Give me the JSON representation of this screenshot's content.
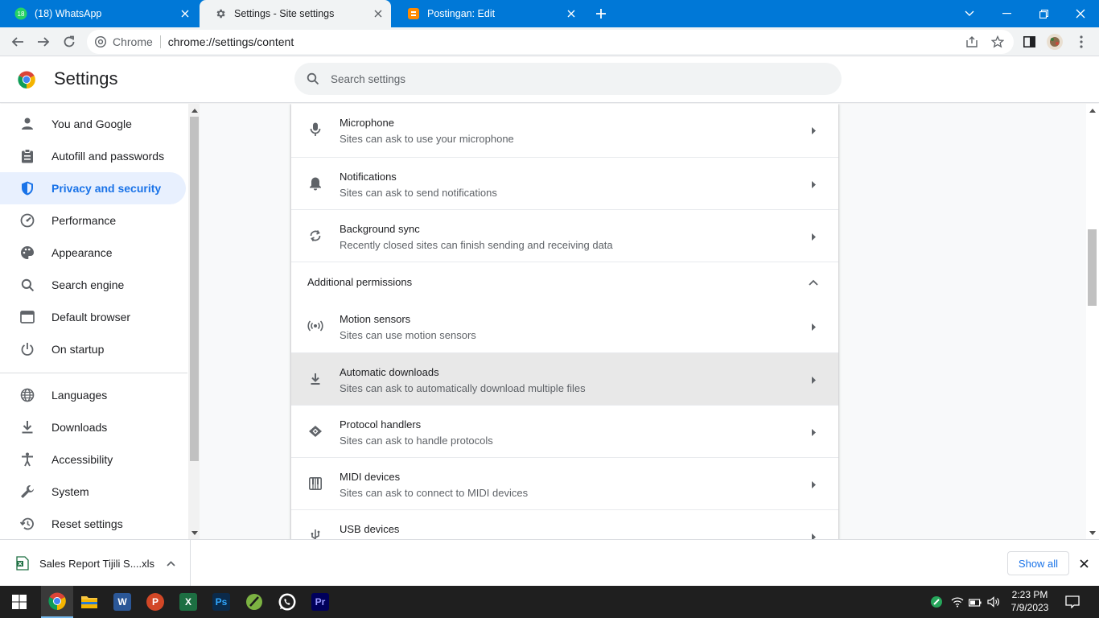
{
  "tabs": [
    {
      "title": "(18) WhatsApp",
      "badge": "18"
    },
    {
      "title": "Settings - Site settings"
    },
    {
      "title": "Postingan: Edit"
    }
  ],
  "omnibox": {
    "chip": "Chrome",
    "url": "chrome://settings/content"
  },
  "header": {
    "title": "Settings",
    "search_placeholder": "Search settings"
  },
  "sidebar": {
    "items": [
      {
        "label": "You and Google",
        "icon": "person-icon"
      },
      {
        "label": "Autofill and passwords",
        "icon": "clipboard-icon"
      },
      {
        "label": "Privacy and security",
        "icon": "shield-icon",
        "active": true
      },
      {
        "label": "Performance",
        "icon": "speedometer-icon"
      },
      {
        "label": "Appearance",
        "icon": "palette-icon"
      },
      {
        "label": "Search engine",
        "icon": "search-icon"
      },
      {
        "label": "Default browser",
        "icon": "browser-window-icon"
      },
      {
        "label": "On startup",
        "icon": "power-icon"
      },
      {
        "label": "Languages",
        "icon": "globe-icon"
      },
      {
        "label": "Downloads",
        "icon": "download-icon"
      },
      {
        "label": "Accessibility",
        "icon": "accessibility-icon"
      },
      {
        "label": "System",
        "icon": "wrench-icon"
      },
      {
        "label": "Reset settings",
        "icon": "history-icon"
      }
    ]
  },
  "content": {
    "rows_top": [
      {
        "title": "Microphone",
        "sub": "Sites can ask to use your microphone",
        "icon": "microphone-icon"
      },
      {
        "title": "Notifications",
        "sub": "Sites can ask to send notifications",
        "icon": "bell-icon"
      },
      {
        "title": "Background sync",
        "sub": "Recently closed sites can finish sending and receiving data",
        "icon": "sync-icon"
      }
    ],
    "section_title": "Additional permissions",
    "rows_additional": [
      {
        "title": "Motion sensors",
        "sub": "Sites can use motion sensors",
        "icon": "sensors-icon"
      },
      {
        "title": "Automatic downloads",
        "sub": "Sites can ask to automatically download multiple files",
        "icon": "download-icon",
        "highlighted": true
      },
      {
        "title": "Protocol handlers",
        "sub": "Sites can ask to handle protocols",
        "icon": "protocol-icon"
      },
      {
        "title": "MIDI devices",
        "sub": "Sites can ask to connect to MIDI devices",
        "icon": "piano-icon"
      },
      {
        "title": "USB devices",
        "sub": "",
        "icon": "usb-icon"
      }
    ]
  },
  "download_shelf": {
    "filename": "Sales Report Tijili S....xls",
    "show_all": "Show all"
  },
  "taskbar": {
    "apps": [
      "Chrome",
      "File Explorer",
      "Word",
      "PowerPoint",
      "Excel",
      "Photoshop",
      "Corel",
      "WhatsApp",
      "Premiere Pro"
    ],
    "glyphs": {
      "word": "W",
      "powerpoint": "P",
      "excel": "X",
      "photoshop": "Ps",
      "premiere": "Pr"
    },
    "time": "2:23 PM",
    "date": "7/9/2023"
  },
  "colors": {
    "accent": "#1a73e8",
    "titlebar": "#0078d7",
    "active_nav_bg": "#e8f0fe"
  }
}
